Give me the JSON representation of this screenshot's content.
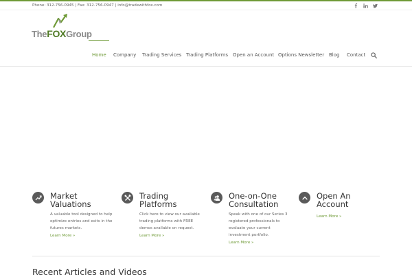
{
  "topbar": {
    "contact": "Phone: 312-756-0945 | Fax: 312-756-0947 | info@tradewithfox.com",
    "social": [
      "facebook-icon",
      "linkedin-icon",
      "twitter-icon"
    ]
  },
  "logo": {
    "the": "The",
    "fox": "FOX",
    "group": "Group"
  },
  "nav": {
    "items": [
      "Home",
      "Company",
      "Trading Services",
      "Trading Platforms",
      "Open an Account",
      "Options Newsletter",
      "Blog",
      "Contact"
    ],
    "active": "Home",
    "search_icon": "search-icon"
  },
  "features": [
    {
      "icon": "chart-icon",
      "title_line1": "Market",
      "title_line2": "Valuations",
      "desc": [
        "A valuable tool designed to help",
        "optimize entries and exits in the",
        "futures markets."
      ],
      "link": "Learn More »"
    },
    {
      "icon": "tools-icon",
      "title_line1": "Trading",
      "title_line2": "Platforms",
      "desc": [
        "Click here to view our available",
        "trading platforms with FREE",
        "demos available on request."
      ],
      "link": "Learn More »"
    },
    {
      "icon": "users-icon",
      "title_line1": "One-on-One",
      "title_line2": "Consultation",
      "desc": [
        "Speak with one of our Series 3",
        "registered professionals to",
        "evaluate your current",
        "investment portfolio."
      ],
      "link": "Learn More »"
    },
    {
      "icon": "chevron-up-icon",
      "title_line1": "Open An",
      "title_line2": "Account",
      "desc": [],
      "link": "Learn More »"
    }
  ],
  "recent": {
    "title": "Recent Articles and Videos"
  },
  "colors": {
    "accent": "#6f9a37",
    "icon_bg": "#5a5a5a"
  }
}
